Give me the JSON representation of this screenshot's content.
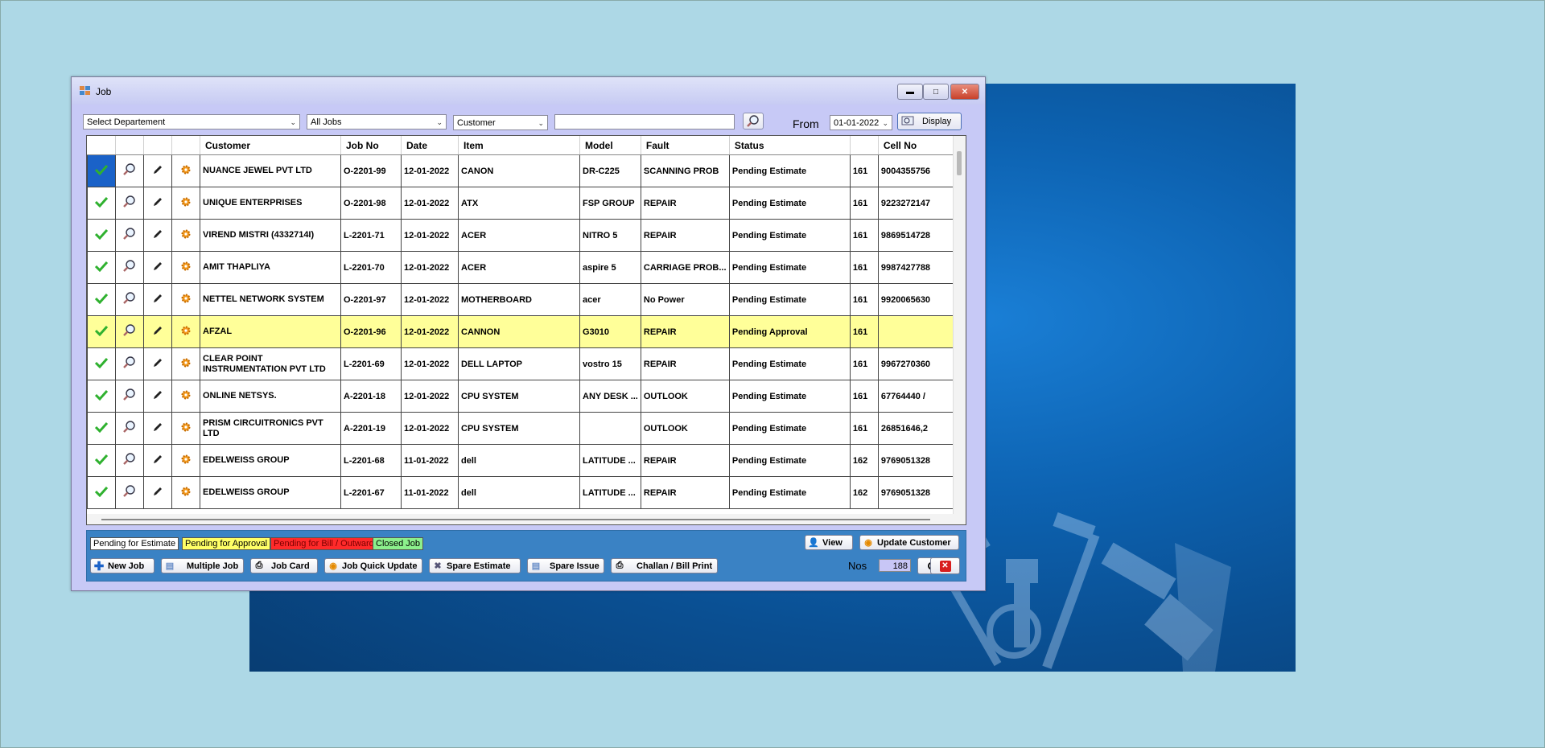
{
  "window": {
    "title": "Job"
  },
  "filters": {
    "department": "Select Departement",
    "jobs": "All Jobs",
    "search_by": "Customer",
    "search_text": "",
    "from_label": "From",
    "from_date": "01-01-2022",
    "display_label": "Display"
  },
  "table": {
    "columns": [
      "Customer",
      "Job No",
      "Date",
      "Item",
      "Model",
      "Fault",
      "Status",
      "",
      "Cell No"
    ],
    "rows": [
      {
        "customer": "NUANCE JEWEL PVT LTD",
        "job_no": "O-2201-99",
        "date": "12-01-2022",
        "item": "CANON",
        "model": "DR-C225",
        "fault": "SCANNING PROB",
        "status": "Pending Estimate",
        "code": "161",
        "cell": "9004355756"
      },
      {
        "customer": "UNIQUE ENTERPRISES",
        "job_no": "O-2201-98",
        "date": "12-01-2022",
        "item": "ATX",
        "model": "FSP GROUP",
        "fault": "REPAIR",
        "status": "Pending Estimate",
        "code": "161",
        "cell": "9223272147"
      },
      {
        "customer": "VIREND MISTRI (4332714I)",
        "job_no": "L-2201-71",
        "date": "12-01-2022",
        "item": "ACER",
        "model": "NITRO 5",
        "fault": "REPAIR",
        "status": "Pending Estimate",
        "code": "161",
        "cell": "9869514728"
      },
      {
        "customer": "AMIT THAPLIYA",
        "job_no": "L-2201-70",
        "date": "12-01-2022",
        "item": "ACER",
        "model": "aspire 5",
        "fault": "CARRIAGE PROB...",
        "status": "Pending Estimate",
        "code": "161",
        "cell": "9987427788"
      },
      {
        "customer": "NETTEL NETWORK SYSTEM",
        "job_no": "O-2201-97",
        "date": "12-01-2022",
        "item": "MOTHERBOARD",
        "model": "acer",
        "fault": "No Power",
        "status": "Pending Estimate",
        "code": "161",
        "cell": "9920065630"
      },
      {
        "customer": "AFZAL",
        "job_no": "O-2201-96",
        "date": "12-01-2022",
        "item": "CANNON",
        "model": "G3010",
        "fault": "REPAIR",
        "status": "Pending Approval",
        "code": "161",
        "cell": ""
      },
      {
        "customer": "CLEAR POINT INSTRUMENTATION PVT LTD",
        "job_no": "L-2201-69",
        "date": "12-01-2022",
        "item": "DELL LAPTOP",
        "model": "vostro 15",
        "fault": "REPAIR",
        "status": "Pending Estimate",
        "code": "161",
        "cell": "9967270360"
      },
      {
        "customer": "ONLINE NETSYS.",
        "job_no": "A-2201-18",
        "date": "12-01-2022",
        "item": "CPU SYSTEM",
        "model": "ANY DESK ...",
        "fault": "OUTLOOK",
        "status": "Pending Estimate",
        "code": "161",
        "cell": "67764440 /"
      },
      {
        "customer": "PRISM CIRCUITRONICS PVT LTD",
        "job_no": "A-2201-19",
        "date": "12-01-2022",
        "item": "CPU SYSTEM",
        "model": "",
        "fault": "OUTLOOK",
        "status": "Pending Estimate",
        "code": "161",
        "cell": "26851646,2"
      },
      {
        "customer": "EDELWEISS GROUP",
        "job_no": "L-2201-68",
        "date": "11-01-2022",
        "item": "dell",
        "model": "LATITUDE ...",
        "fault": "REPAIR",
        "status": "Pending Estimate",
        "code": "162",
        "cell": "9769051328"
      },
      {
        "customer": "EDELWEISS GROUP",
        "job_no": "L-2201-67",
        "date": "11-01-2022",
        "item": "dell",
        "model": "LATITUDE ...",
        "fault": "REPAIR",
        "status": "Pending Estimate",
        "code": "162",
        "cell": "9769051328"
      }
    ]
  },
  "legend": {
    "estimate": "Pending for Estimate",
    "approval": "Pending for Approval",
    "bill": "Pending for Bill / Outward",
    "closed": "Closed Job"
  },
  "buttons": {
    "view": "View",
    "update_customer": "Update Customer",
    "new_job": "New Job",
    "multiple_job": "Multiple Job",
    "job_card": "Job Card",
    "job_quick_update": "Job Quick Update",
    "spare_estimate": "Spare Estimate",
    "spare_issue": "Spare Issue",
    "challan_bill_print": "Challan / Bill Print"
  },
  "footer": {
    "nos_label": "Nos",
    "nos_value": "188"
  },
  "colors": {
    "selected": "#1a62c8",
    "highlight_row": "#ffff99",
    "legend_estimate": "#ffffff",
    "legend_approval": "#ffff66",
    "legend_bill": "#ff2a2a",
    "legend_closed": "#8cf08c"
  }
}
